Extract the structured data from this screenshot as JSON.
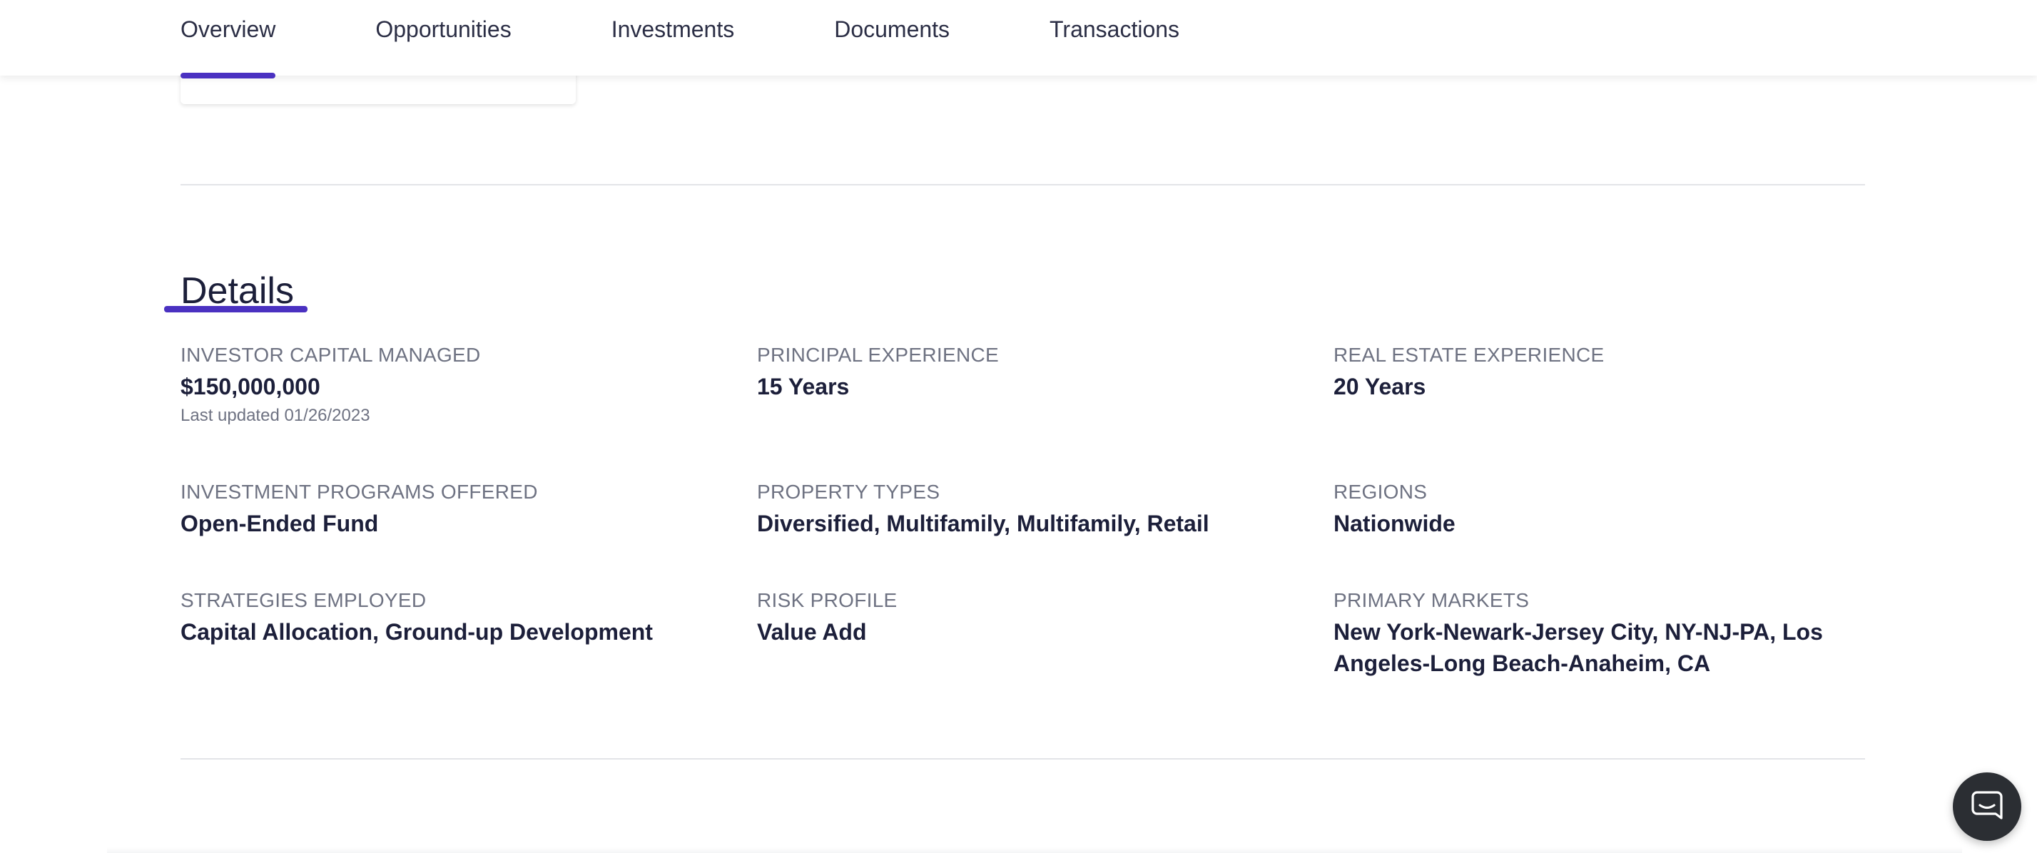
{
  "nav": {
    "tabs": [
      {
        "label": "Overview",
        "active": true
      },
      {
        "label": "Opportunities",
        "active": false
      },
      {
        "label": "Investments",
        "active": false
      },
      {
        "label": "Documents",
        "active": false
      },
      {
        "label": "Transactions",
        "active": false
      }
    ]
  },
  "details": {
    "title": "Details",
    "investor_capital_managed": {
      "label": "INVESTOR CAPITAL MANAGED",
      "value": "$150,000,000",
      "note": "Last updated 01/26/2023"
    },
    "principal_experience": {
      "label": "PRINCIPAL EXPERIENCE",
      "value": "15 Years"
    },
    "real_estate_experience": {
      "label": "REAL ESTATE EXPERIENCE",
      "value": "20 Years"
    },
    "investment_programs_offered": {
      "label": "INVESTMENT PROGRAMS OFFERED",
      "value": "Open-Ended Fund"
    },
    "property_types": {
      "label": "PROPERTY TYPES",
      "value": "Diversified, Multifamily, Multifamily, Retail"
    },
    "regions": {
      "label": "REGIONS",
      "value": "Nationwide"
    },
    "strategies_employed": {
      "label": "STRATEGIES EMPLOYED",
      "value": "Capital Allocation, Ground-up Development"
    },
    "risk_profile": {
      "label": "RISK PROFILE",
      "value": "Value Add"
    },
    "primary_markets": {
      "label": "PRIMARY MARKETS",
      "value": "New York-Newark-Jersey City, NY-NJ-PA, Los Angeles-Long Beach-Anaheim, CA"
    }
  },
  "chat": {
    "icon": "chat-bubble-icon"
  },
  "colors": {
    "accent": "#4a31c1",
    "label_gray": "#6e7282",
    "text_dark": "#1c1f3a",
    "chat_bg": "#2b2e33"
  }
}
